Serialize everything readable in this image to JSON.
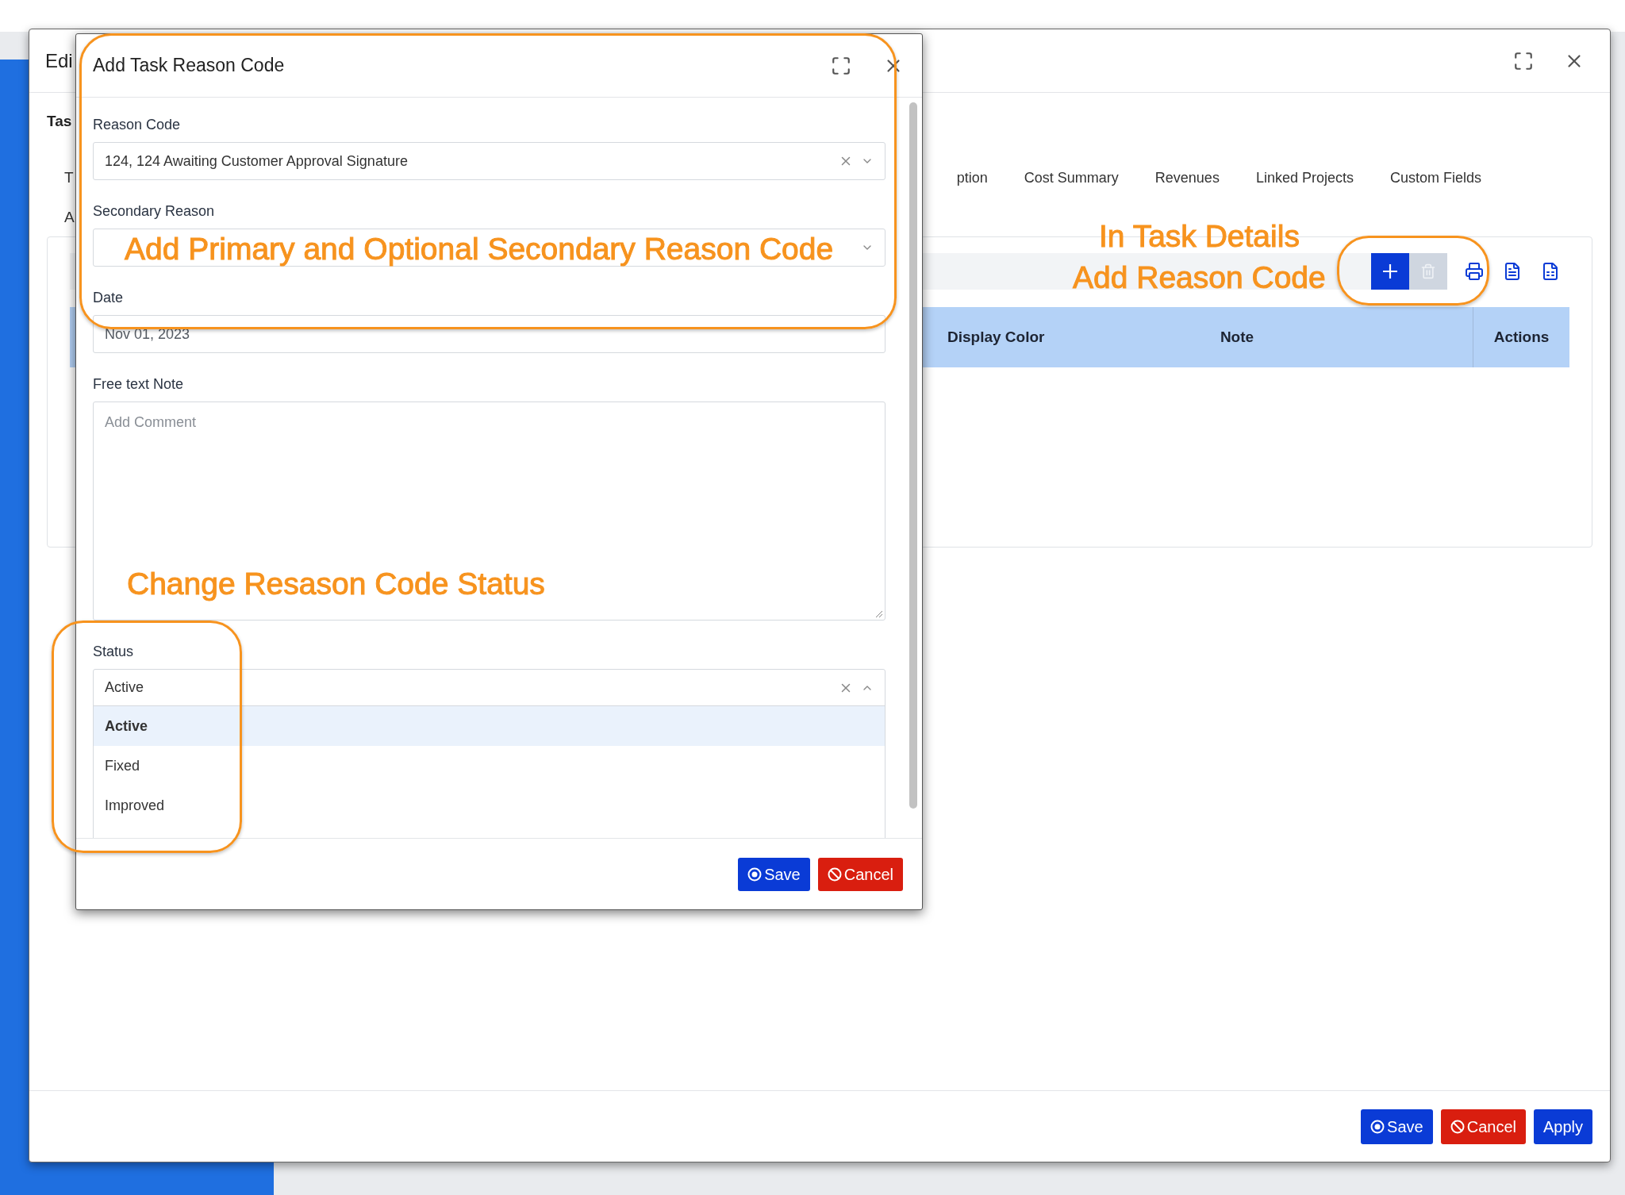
{
  "back_window": {
    "title": "Edi",
    "section": "Tas",
    "tabs": [
      {
        "label": "T"
      },
      {
        "label": "ption"
      },
      {
        "label": "Cost Summary"
      },
      {
        "label": "Revenues"
      },
      {
        "label": "Linked Projects"
      },
      {
        "label": "Custom Fields"
      },
      {
        "label": "A"
      }
    ],
    "toolbar": [
      {
        "kind": "add",
        "disabled": false
      },
      {
        "kind": "delete",
        "disabled": true
      },
      {
        "kind": "print",
        "disabled": false
      },
      {
        "kind": "csv",
        "disabled": false
      },
      {
        "kind": "excel",
        "disabled": false
      }
    ],
    "table": {
      "columns": [
        "Display Color",
        "Note",
        "Actions"
      ]
    },
    "buttons": [
      {
        "label": "Save",
        "kind": "save"
      },
      {
        "label": "Cancel",
        "kind": "cancel"
      },
      {
        "label": "Apply",
        "kind": "apply"
      }
    ]
  },
  "dialog": {
    "title": "Add Task Reason Code",
    "fields": [
      {
        "label": "Reason Code",
        "kind": "select",
        "value": "124, 124 Awaiting Customer Approval Signature",
        "clearable": true
      },
      {
        "label": "Secondary Reason",
        "kind": "select",
        "clearable": false
      },
      {
        "label": "Date",
        "kind": "date",
        "value": "Nov 01, 2023"
      },
      {
        "label": "Free text Note",
        "kind": "textarea",
        "placeholder": "Add Comment"
      },
      {
        "label": "Status",
        "kind": "select",
        "value": "Active",
        "clearable": true,
        "expanded": true,
        "options": [
          {
            "label": "Active",
            "selected": true
          },
          {
            "label": "Fixed",
            "selected": false
          },
          {
            "label": "Improved",
            "selected": false
          }
        ]
      }
    ],
    "buttons": [
      {
        "label": "Save",
        "kind": "save"
      },
      {
        "label": "Cancel",
        "kind": "cancel"
      }
    ]
  },
  "annotations": [
    {
      "text": "Add Primary and Optional Secondary Reason Code"
    },
    {
      "text": "Change Resason Code Status"
    },
    {
      "text": "In Task Details"
    },
    {
      "text": "Add Reason Code"
    }
  ]
}
